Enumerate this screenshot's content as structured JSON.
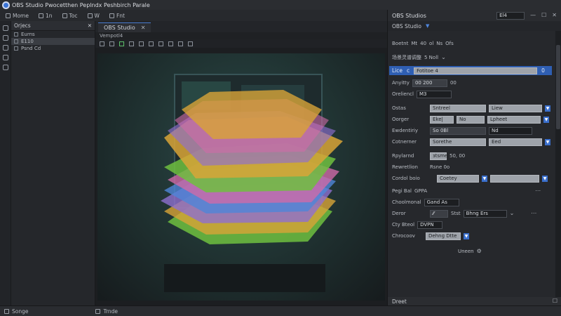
{
  "window": {
    "title": "OBS Studio Pwocetthen Peplndx Peshbirch Parale",
    "controls": {
      "minimize": "—",
      "maximize": "☐",
      "close": "✕"
    }
  },
  "menubar": {
    "items": [
      {
        "label": "Mome"
      },
      {
        "label": "1n"
      },
      {
        "label": "Toc"
      },
      {
        "label": "W"
      },
      {
        "label": "Fnt"
      }
    ]
  },
  "scenes_panel": {
    "title": "Orjecs",
    "rows": [
      "Eurns",
      "E110",
      "Psnd Cd"
    ]
  },
  "center": {
    "tab_label": "OBS Studio",
    "tab_close": "✕",
    "subtitle": "Vempotl4",
    "accent": "#4a7bd0"
  },
  "right_panel": {
    "header_title": "OBS Studios",
    "header_field": "El4",
    "sub_title": "OBS Studio",
    "rows": {
      "r1": {
        "label": "Boetnt",
        "mid": "Mt",
        "a": "40",
        "b": "ol",
        "c": "Ns",
        "d": "Ofs"
      },
      "r2": {
        "label": "场景灵谱调整",
        "value": "5 Noll"
      },
      "selected": {
        "label": "Lice",
        "glyph": "c",
        "value": "Fotitoe 4",
        "num": "0"
      },
      "r3": {
        "label": "Anyitty",
        "value": "00 200",
        "suffix": "00"
      },
      "r4": {
        "label": "Oreliencl",
        "value": "M3"
      },
      "r5": {
        "label": "Ostas",
        "v1": "Sntreel",
        "v2": "Liew"
      },
      "r6": {
        "label": "Oorger",
        "v1": "Eke|",
        "v2": "No",
        "v3": "Lpheet"
      },
      "r7": {
        "label": "Ewdentiriy",
        "v1": "So 0Bl",
        "v2": "Nd"
      },
      "r8": {
        "label": "Cotnerner",
        "v1": "Sorethe",
        "v2": "Eed"
      },
      "r9": {
        "label": "Rpylarnd",
        "v1": "ɜtsme",
        "v2": "50, 00"
      },
      "r10": {
        "label": "Rewretlion",
        "v1": "Rsne 0o"
      },
      "r11": {
        "label": "Cordol boio",
        "v1": "Coetey"
      },
      "r12": {
        "label": "Pegi Bal",
        "v1": "GPPA"
      },
      "r13": {
        "label": "Choolmonal",
        "v1": "Gand As"
      },
      "r14": {
        "label": "Deror",
        "v1": "Stst",
        "v2": "Bhng Ers"
      },
      "r15": {
        "label": "Cty Bteol",
        "v1": "DVPN"
      },
      "r16": {
        "label": "Chrocoov",
        "v1": "Dehng Dtte"
      }
    },
    "link_label": "Uneen",
    "footer_label": "Dreet"
  },
  "statusbar": {
    "left_label": "Songe",
    "mid_label": "Trnde"
  },
  "colors": {
    "selection": "#2f5fb3",
    "dropdown_accent": "#3a6fcc"
  }
}
